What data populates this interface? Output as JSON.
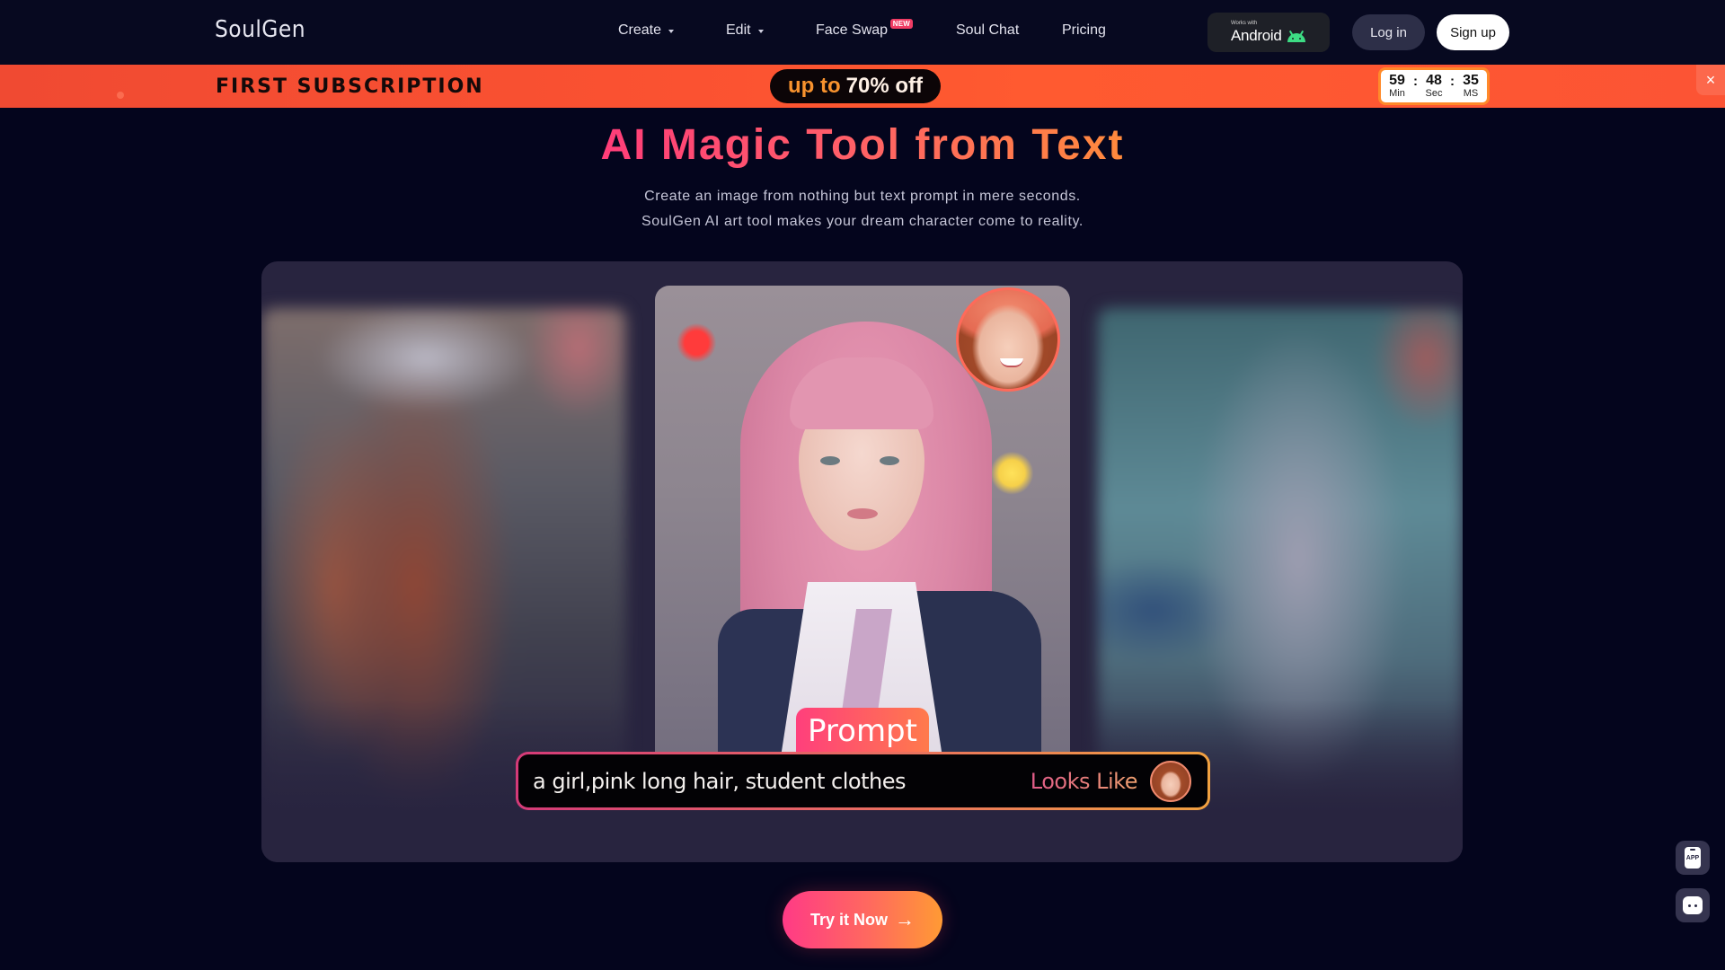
{
  "header": {
    "logo": "SoulGen",
    "nav": [
      {
        "label": "Create",
        "has_dropdown": true
      },
      {
        "label": "Edit",
        "has_dropdown": true
      },
      {
        "label": "Face Swap",
        "badge": "NEW"
      },
      {
        "label": "Soul Chat"
      },
      {
        "label": "Pricing"
      }
    ],
    "android_badge": {
      "small_text": "Works with",
      "label": "Android",
      "icon": "android-icon"
    },
    "login_label": "Log in",
    "signup_label": "Sign up"
  },
  "promo": {
    "title": "FIRST SUBSCRIPTION",
    "offer_prefix": "up to",
    "offer_value": "70% off",
    "timer": {
      "minutes": "59",
      "seconds": "48",
      "ms": "35",
      "min_label": "Min",
      "sec_label": "Sec",
      "ms_label": "MS",
      "separator": ":"
    },
    "close_icon": "×",
    "colors": {
      "banner": "#fb5231",
      "timer_border": "#ff8a2a"
    }
  },
  "hero": {
    "title": "AI Magic Tool from Text",
    "subtitle_line1": "Create an image from nothing but text prompt in mere seconds.",
    "subtitle_line2": "SoulGen AI art tool makes your dream character come to reality."
  },
  "showcase": {
    "prompt_tag": "Prompt",
    "prompt_text": "a girl,pink long hair, student clothes",
    "looks_like_label": "Looks Like"
  },
  "cta": {
    "label": "Try it Now",
    "arrow": "→",
    "gradient": [
      "#ff3a86",
      "#ff9a34"
    ]
  },
  "floating": {
    "app_label": "APP"
  }
}
